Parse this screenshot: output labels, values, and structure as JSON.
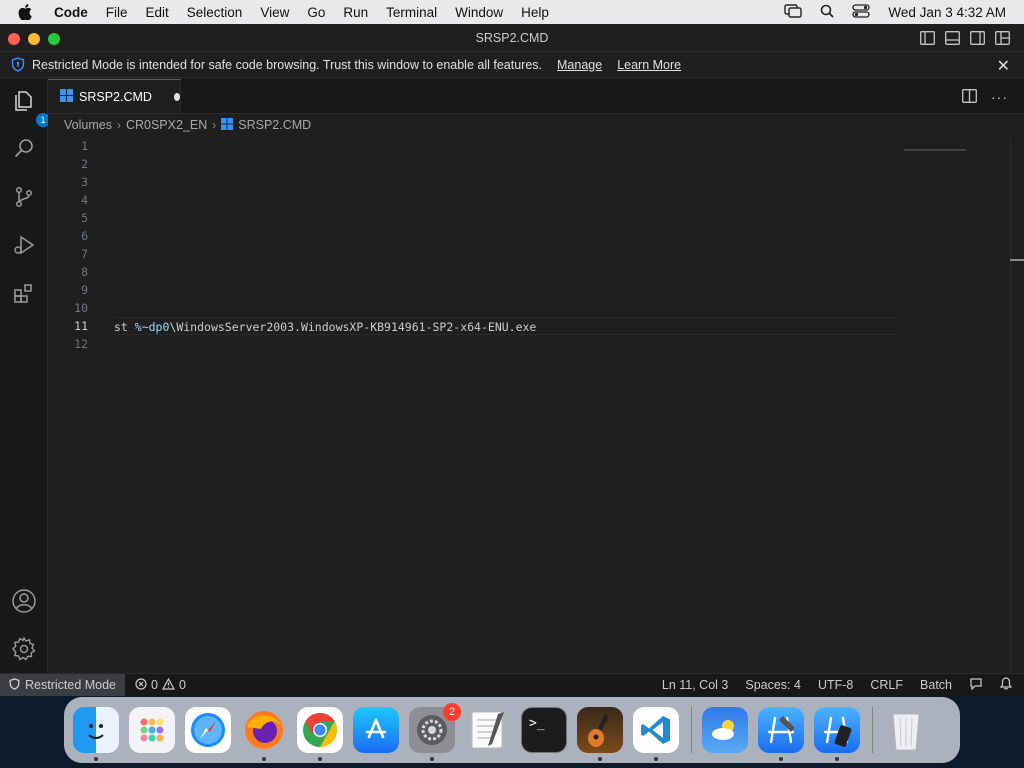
{
  "menubar": {
    "app": "Code",
    "items": [
      "File",
      "Edit",
      "Selection",
      "View",
      "Go",
      "Run",
      "Terminal",
      "Window",
      "Help"
    ],
    "clock": "Wed Jan 3  4:32 AM"
  },
  "window": {
    "title": "SRSP2.CMD"
  },
  "banner": {
    "message": "Restricted Mode is intended for safe code browsing. Trust this window to enable all features.",
    "manage": "Manage",
    "learn_more": "Learn More"
  },
  "activity": {
    "explorer_badge": "1"
  },
  "tab": {
    "label": "SRSP2.CMD"
  },
  "breadcrumb": {
    "parts": [
      "Volumes",
      "CR0SPX2_EN",
      "SRSP2.CMD"
    ]
  },
  "editor": {
    "line_numbers": [
      "1",
      "2",
      "3",
      "4",
      "5",
      "6",
      "7",
      "8",
      "9",
      "10",
      "11",
      "12"
    ],
    "line11_prefix": "st ",
    "line11_var": "%~dp0",
    "line11_rest": "\\WindowsServer2003.WindowsXP-KB914961-SP2-x64-ENU.exe"
  },
  "statusbar": {
    "restricted": "Restricted Mode",
    "errors": "0",
    "warnings": "0",
    "position": "Ln 11, Col 3",
    "spaces": "Spaces: 4",
    "encoding": "UTF-8",
    "eol": "CRLF",
    "language": "Batch"
  },
  "dock": {
    "apps": [
      "finder",
      "launchpad",
      "safari",
      "firefox",
      "chrome",
      "app-store",
      "system-settings",
      "textedit",
      "terminal",
      "garageband",
      "vscode",
      "weather",
      "xcode",
      "simulator",
      "trash"
    ],
    "settings_badge": "2"
  },
  "colors": {
    "accent": "#0078d4",
    "editor_bg": "#1f1f1f",
    "variable": "#9cdcfe"
  }
}
